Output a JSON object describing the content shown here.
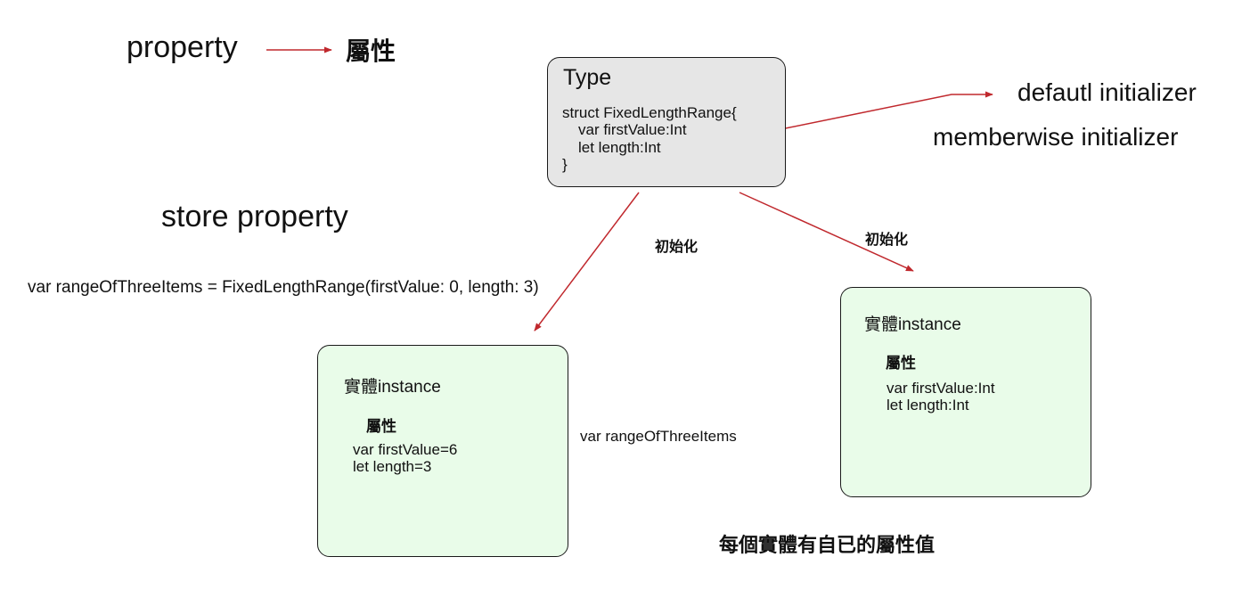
{
  "legend": {
    "property": "property",
    "property_cn": "屬性"
  },
  "heading": {
    "store_property": "store property"
  },
  "type_box": {
    "title": "Type",
    "code_line_1": "struct FixedLengthRange{",
    "code_line_2": "var firstValue:Int",
    "code_line_3": "let length:Int",
    "code_line_4": "}"
  },
  "initializers": {
    "default": "defautl initializer",
    "memberwise": "memberwise initializer"
  },
  "arrow_labels": {
    "init_left": "初始化",
    "init_right": "初始化"
  },
  "statement": {
    "declaration": "var rangeOfThreeItems = FixedLengthRange(firstValue: 0, length: 3)",
    "variable_label": "var rangeOfThreeItems"
  },
  "instance_left": {
    "title": "實體instance",
    "subtitle": "屬性",
    "line_1": "var firstValue=6",
    "line_2": "let length=3"
  },
  "instance_right": {
    "title": "實體instance",
    "subtitle": "屬性",
    "line_1": "var firstValue:Int",
    "line_2": "let length:Int"
  },
  "footer": {
    "note": "每個實體有自已的屬性值"
  },
  "colors": {
    "arrow": "#c0282d",
    "type_fill": "#e6e6e6",
    "instance_fill": "#e9fce9",
    "border": "#1a1a1a"
  }
}
